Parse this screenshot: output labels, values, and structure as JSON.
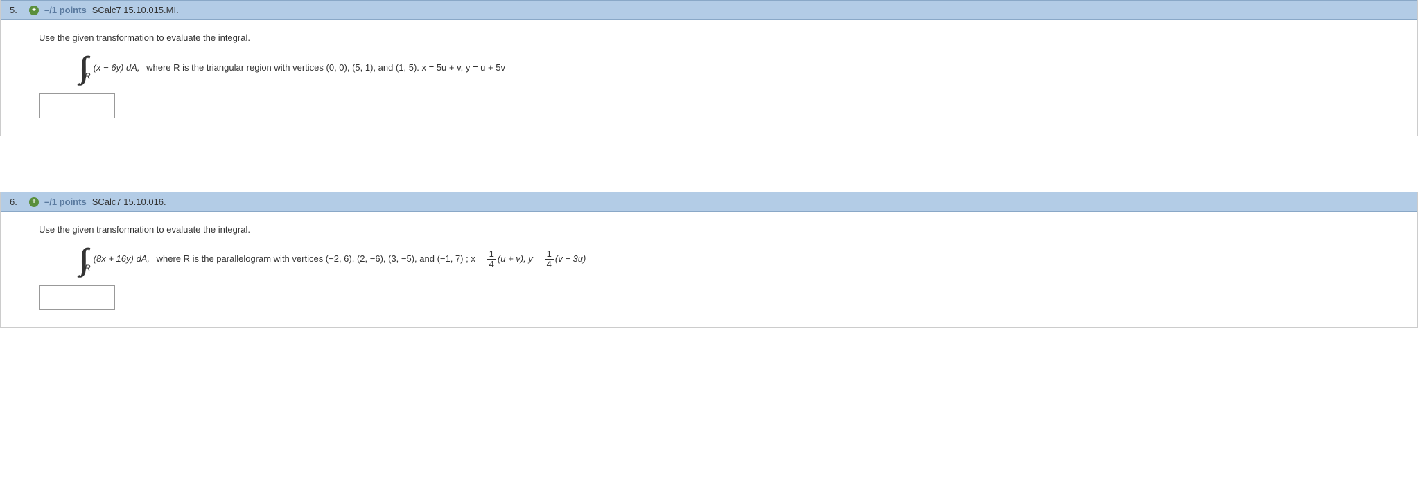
{
  "questions": [
    {
      "number": "5.",
      "points": "–/1 points",
      "bookRef": "SCalc7 15.10.015.MI.",
      "prompt": "Use the given transformation to evaluate the integral.",
      "intSub": "R",
      "integrand": "(x − 6y) dA,",
      "whereText": "where R is the triangular region with vertices (0, 0), (5, 1), and (1, 5).  x = 5u + v, y = u + 5v",
      "useFractions": false
    },
    {
      "number": "6.",
      "points": "–/1 points",
      "bookRef": "SCalc7 15.10.016.",
      "prompt": "Use the given transformation to evaluate the integral.",
      "intSub": "R",
      "integrand": "(8x + 16y) dA,",
      "whereText": "where R is the parallelogram with vertices  (−2, 6),   (2, −6),   (3, −5),  and  (−1, 7) ;   x = ",
      "frac1num": "1",
      "frac1den": "4",
      "mid1": "(u + v),  y = ",
      "frac2num": "1",
      "frac2den": "4",
      "tail": "(v − 3u)",
      "useFractions": true
    }
  ]
}
